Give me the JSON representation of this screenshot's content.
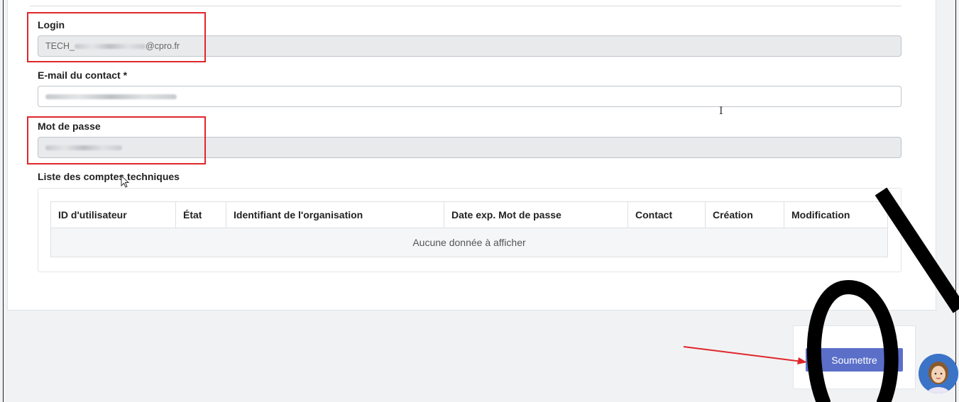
{
  "form": {
    "login": {
      "label": "Login",
      "value_prefix": "TECH_",
      "value_suffix": "@cpro.fr"
    },
    "email": {
      "label": "E-mail du contact *"
    },
    "password": {
      "label": "Mot de passe"
    },
    "list_title": "Liste des comptes techniques"
  },
  "table": {
    "columns": [
      "ID d'utilisateur",
      "État",
      "Identifiant de l'organisation",
      "Date exp. Mot de passe",
      "Contact",
      "Création",
      "Modification"
    ],
    "empty_text": "Aucune donnée à afficher"
  },
  "actions": {
    "submit_label": "Soumettre"
  },
  "colors": {
    "accent": "#5b6fc9",
    "highlight": "#e0262b",
    "arrow": "#e0262b"
  },
  "icons": {
    "assistant": "assistant-avatar-icon",
    "text_cursor": "text-cursor-icon",
    "mouse_pointer": "mouse-pointer-icon"
  }
}
